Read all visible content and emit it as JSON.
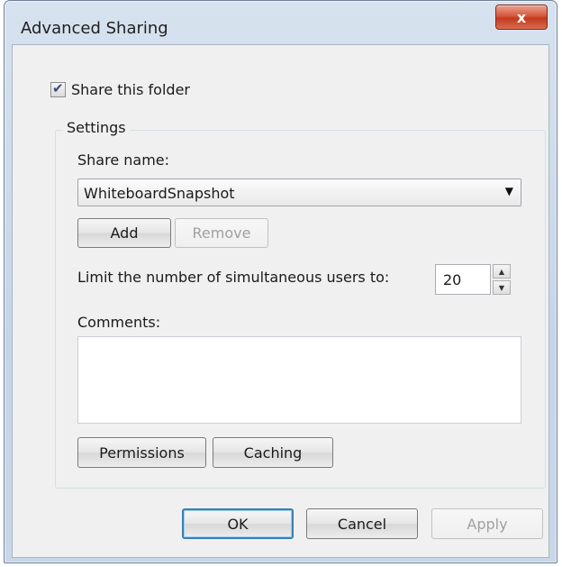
{
  "window": {
    "title": "Advanced Sharing",
    "close_glyph": "x"
  },
  "share": {
    "checkbox_label": "Share this folder",
    "checked": true
  },
  "settings": {
    "group_label": "Settings",
    "share_name_label": "Share name:",
    "share_name_value": "WhiteboardSnapshot",
    "add_label": "Add",
    "remove_label": "Remove",
    "limit_label": "Limit the number of simultaneous users to:",
    "limit_value": "20",
    "comments_label": "Comments:",
    "comments_value": "",
    "permissions_label": "Permissions",
    "caching_label": "Caching"
  },
  "footer": {
    "ok_label": "OK",
    "cancel_label": "Cancel",
    "apply_label": "Apply"
  },
  "icons": {
    "dropdown": "chevron-down-icon",
    "spin_up": "spin-up-icon",
    "spin_down": "spin-down-icon",
    "close": "close-icon",
    "check": "checkmark-icon"
  },
  "colors": {
    "title_bar": "#c9d7e8",
    "close_button": "#d5573c",
    "client_bg": "#f0f0f0",
    "default_button_border": "#3c7fb1"
  }
}
